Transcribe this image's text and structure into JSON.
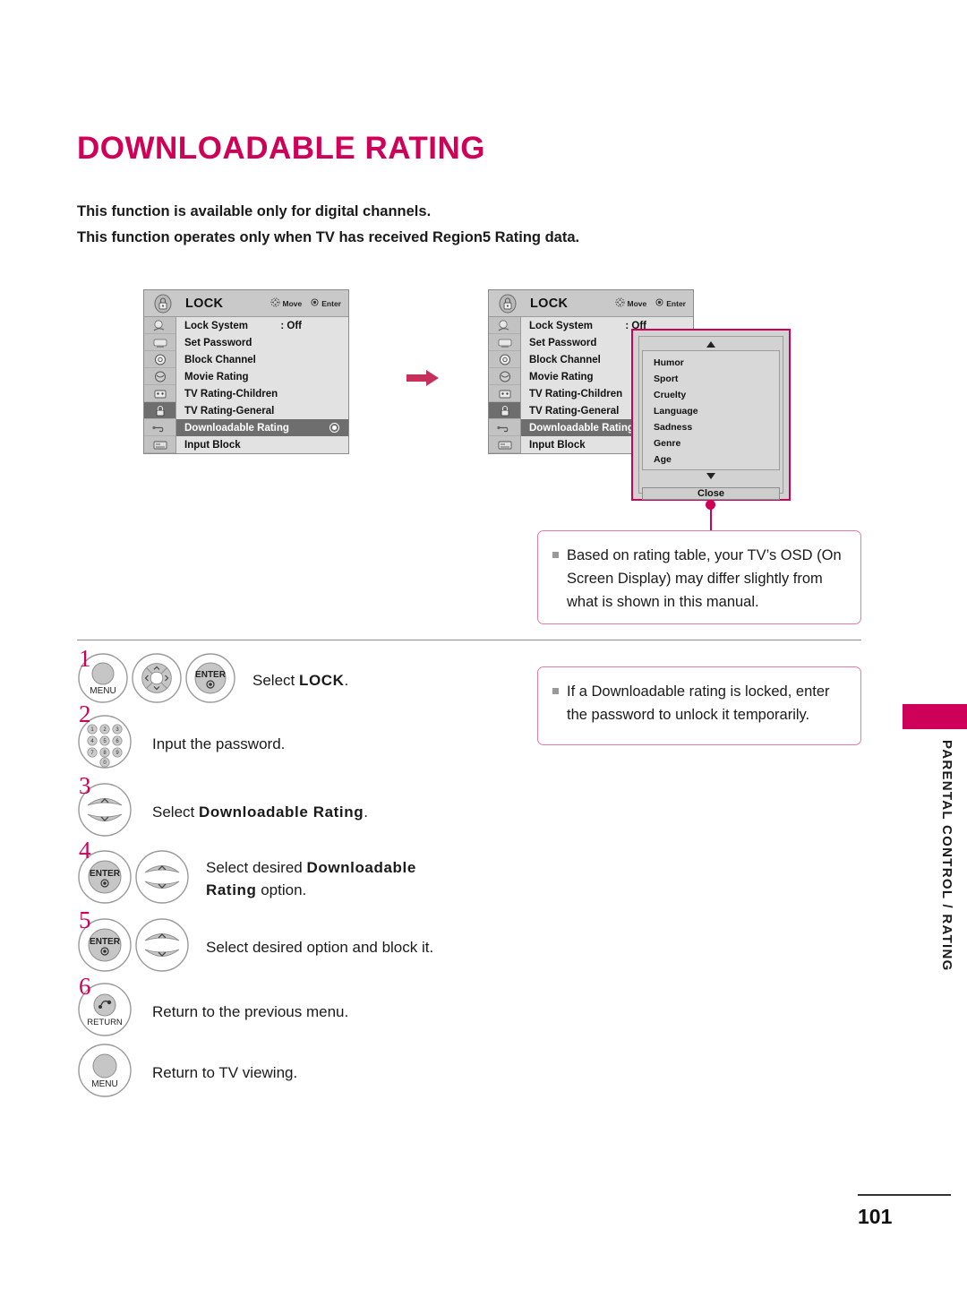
{
  "page": {
    "title": "DOWNLOADABLE RATING",
    "number": "101",
    "side_tab_label": "PARENTAL CONTROL / RATING",
    "accent_color": "#CE0058",
    "note_border_color": "#E878A8"
  },
  "intro": {
    "line1": "This function is available only for digital channels.",
    "line2": "This function operates only when TV has received Region5 Rating data."
  },
  "osd": {
    "title": "LOCK",
    "hint_move": "Move",
    "hint_enter": "Enter",
    "items": [
      {
        "label": "Lock System",
        "value": ": Off"
      },
      {
        "label": "Set Password",
        "value": ""
      },
      {
        "label": "Block Channel",
        "value": ""
      },
      {
        "label": "Movie Rating",
        "value": ""
      },
      {
        "label": "TV Rating-Children",
        "value": ""
      },
      {
        "label": "TV Rating-General",
        "value": ""
      },
      {
        "label": "Downloadable Rating",
        "value": ""
      },
      {
        "label": "Input Block",
        "value": ""
      }
    ],
    "selected_index": 6,
    "sidebar_icons": [
      "picture-icon",
      "audio-icon",
      "time-icon",
      "option-icon",
      "parental-icon",
      "lock-icon",
      "usb-icon",
      "input-icon"
    ],
    "header_icon": "lock-icon"
  },
  "rating_popup": {
    "scroll_up_icon": "triangle-up-icon",
    "scroll_down_icon": "triangle-down-icon",
    "options": [
      "Humor",
      "Sport",
      "Cruelty",
      "Language",
      "Sadness",
      "Genre",
      "Age"
    ],
    "close_label": "Close"
  },
  "notes": [
    {
      "id": "note-osd",
      "text": "Based on rating table, your TV’s OSD (On Screen Display) may differ slightly from what is shown in this manual."
    },
    {
      "id": "note-lock",
      "text": "If a Downloadable rating is locked, enter the password to unlock it temporarily."
    }
  ],
  "steps": [
    {
      "num": "1",
      "buttons": [
        "menu-button",
        "nav-pad-button",
        "enter-button"
      ],
      "text_pre": "Select ",
      "text_bold": "LOCK",
      "text_post": "."
    },
    {
      "num": "2",
      "buttons": [
        "number-pad-button"
      ],
      "text_pre": "Input the password.",
      "text_bold": "",
      "text_post": ""
    },
    {
      "num": "3",
      "buttons": [
        "updown-button"
      ],
      "text_pre": "Select ",
      "text_bold": "Downloadable Rating",
      "text_post": "."
    },
    {
      "num": "4",
      "buttons": [
        "enter-button",
        "updown-button"
      ],
      "text_pre": "Select desired ",
      "text_bold": "Downloadable Rating",
      "text_post": " option."
    },
    {
      "num": "5",
      "buttons": [
        "enter-button",
        "updown-button"
      ],
      "text_pre": "Select desired option and block it.",
      "text_bold": "",
      "text_post": ""
    },
    {
      "num": "6",
      "buttons": [
        "return-button"
      ],
      "text_pre": "Return to the previous menu.",
      "text_bold": "",
      "text_post": ""
    },
    {
      "num": "",
      "buttons": [
        "menu-button"
      ],
      "text_pre": "Return to TV viewing.",
      "text_bold": "",
      "text_post": ""
    }
  ],
  "button_labels": {
    "menu": "MENU",
    "enter": "ENTER",
    "return": "RETURN"
  },
  "number_pad_keys": [
    "1",
    "2",
    "3",
    "4",
    "5",
    "6",
    "7",
    "8",
    "9",
    "0"
  ]
}
